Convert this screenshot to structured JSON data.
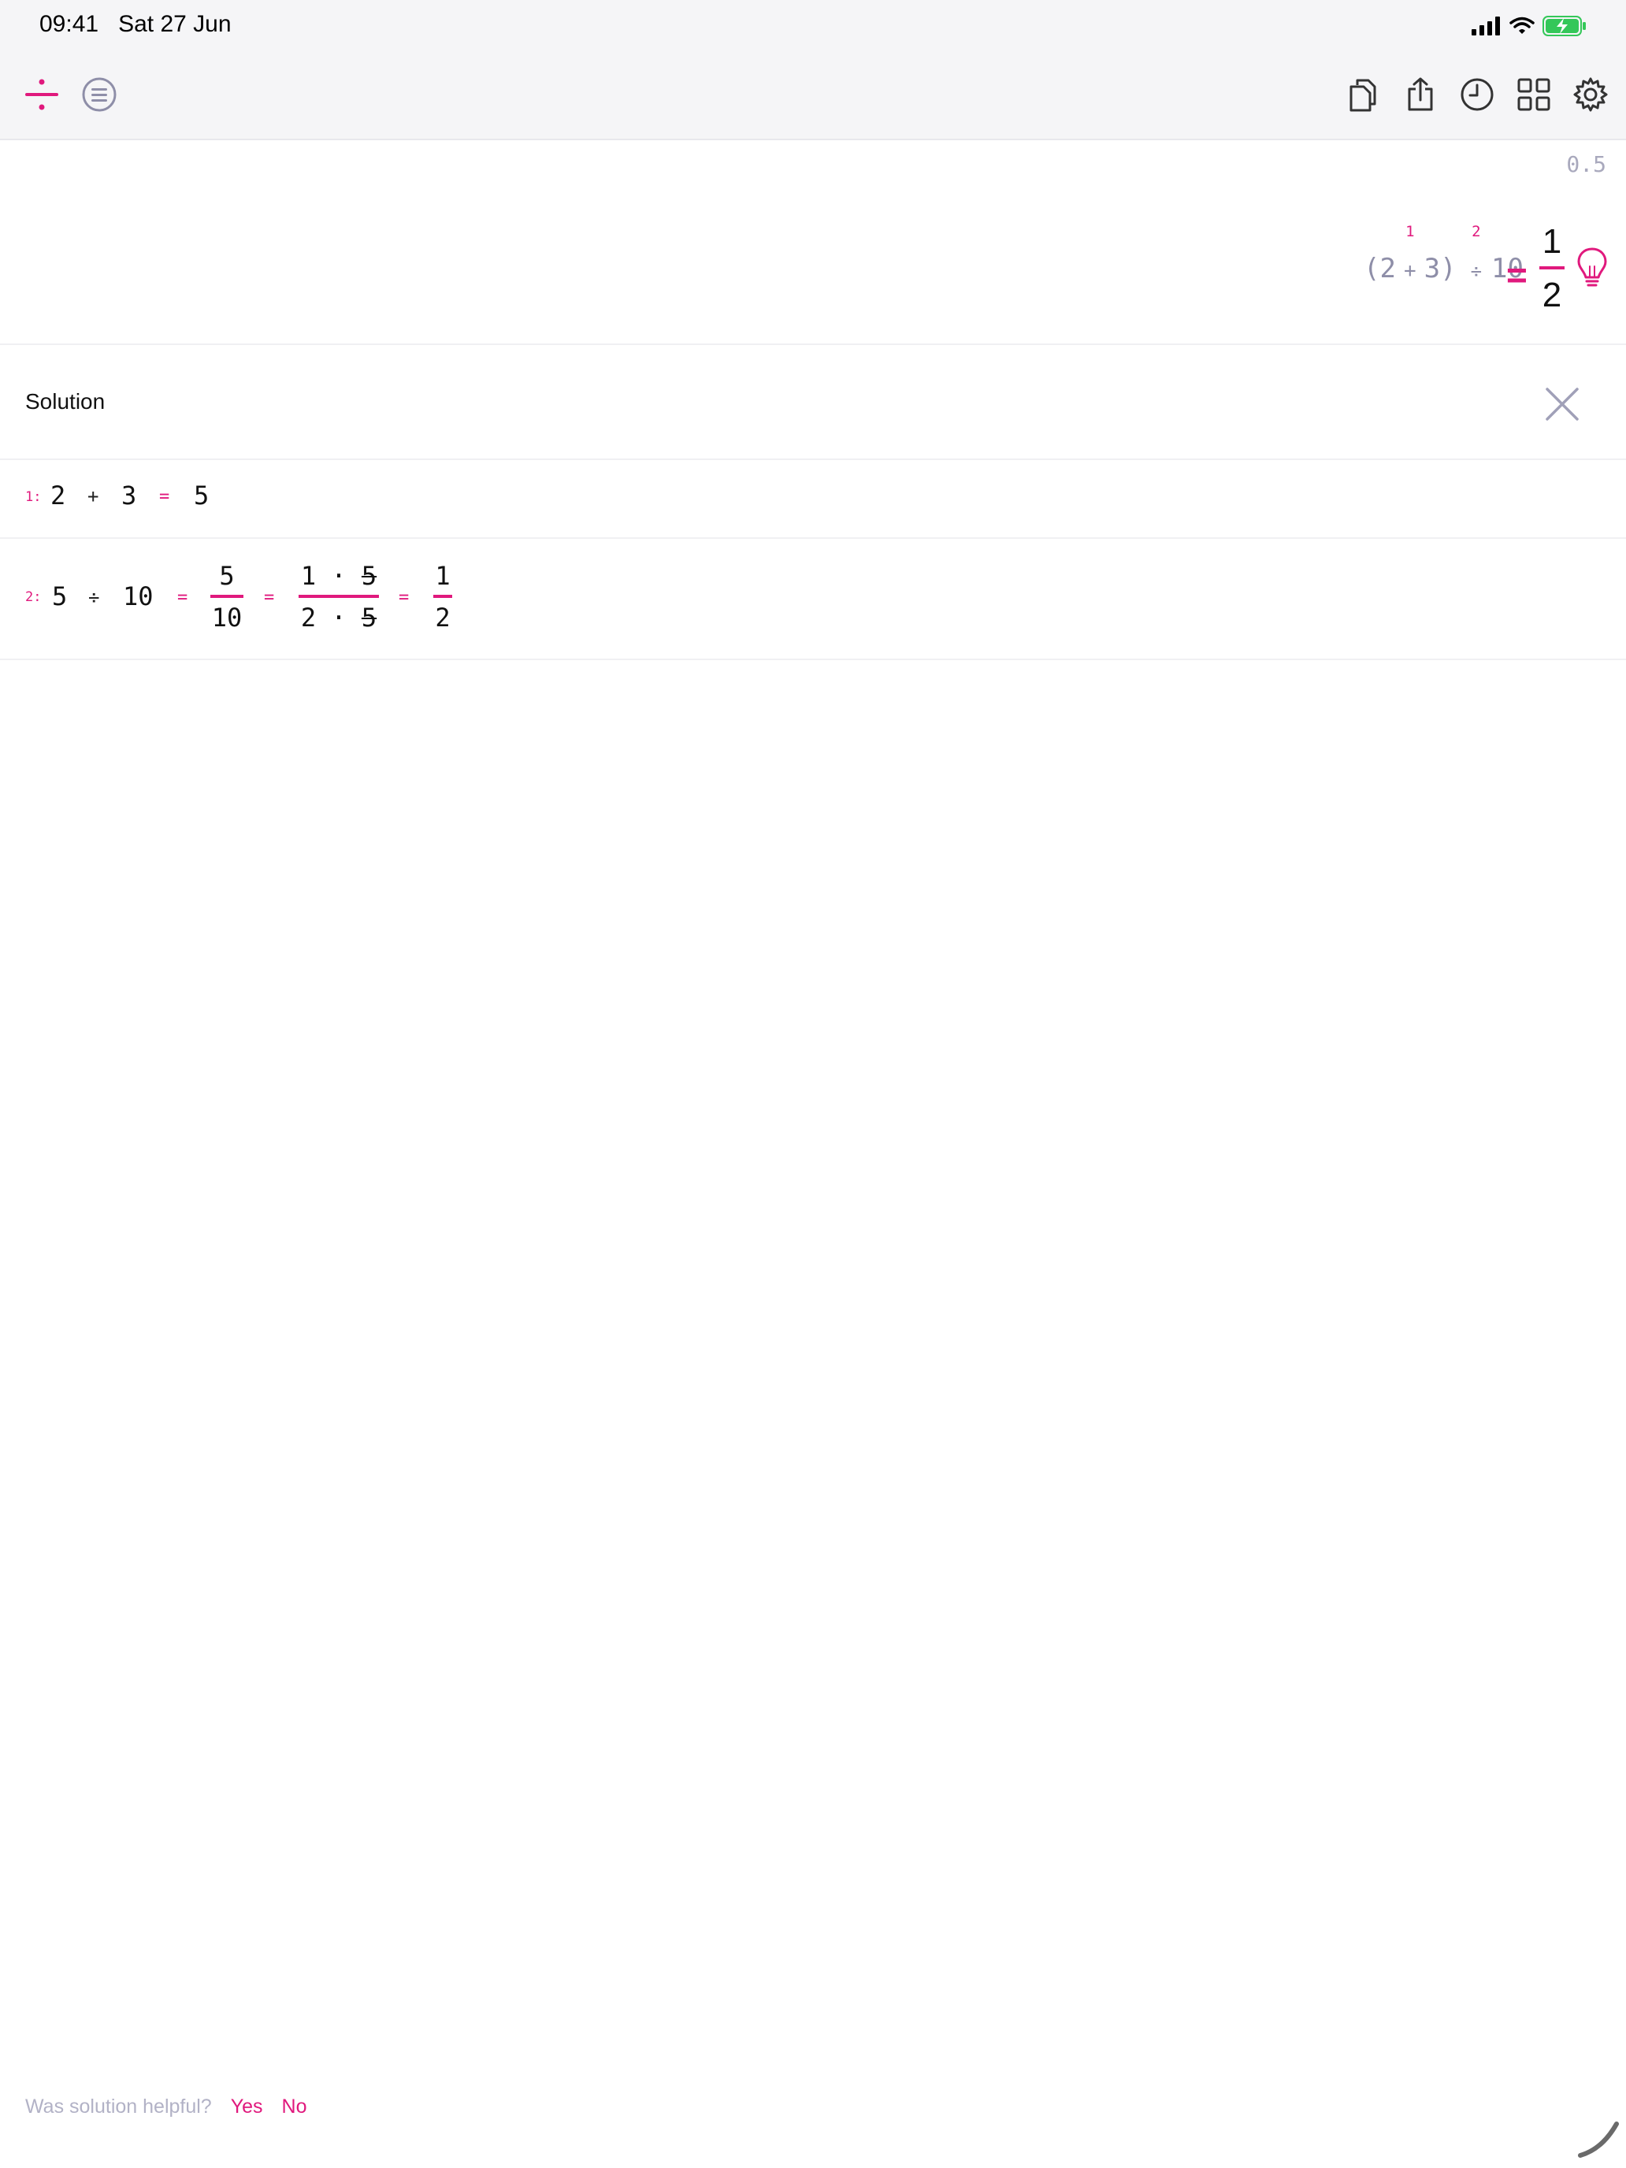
{
  "status_bar": {
    "time": "09:41",
    "date": "Sat 27 Jun",
    "icons": [
      "signal-icon",
      "wifi-icon",
      "battery-charging-icon"
    ],
    "battery_color": "#34c759"
  },
  "toolbar": {
    "left_icons": [
      "divide-icon",
      "equals-circle-icon"
    ],
    "right_icons": [
      "copy-icon",
      "share-icon",
      "history-icon",
      "grid-icon",
      "gear-icon"
    ],
    "accent_color": "#e0197d"
  },
  "display": {
    "preview_value": "0.5",
    "expression": {
      "open_paren": "(",
      "a": "2",
      "plus": "+",
      "b": "3",
      "close_paren": ")",
      "div": "÷",
      "c": "10",
      "step1": "1",
      "step2": "2"
    },
    "equals": "=",
    "result_num": "1",
    "result_den": "2",
    "hint_icon": "lightbulb-icon"
  },
  "solution": {
    "title": "Solution",
    "close_icon": "close-icon",
    "steps": [
      {
        "index": "1:",
        "a": "2",
        "op": "+",
        "b": "3",
        "eq": "=",
        "result": "5"
      },
      {
        "index": "2:",
        "a": "5",
        "op": "÷",
        "b": "10",
        "eq1": "=",
        "f1_num": "5",
        "f1_den": "10",
        "eq2": "=",
        "f2_num_a": "1",
        "f2_dot": "·",
        "f2_num_b": "5",
        "f2_den_a": "2",
        "f2_den_b": "5",
        "eq3": "=",
        "f3_num": "1",
        "f3_den": "2"
      }
    ]
  },
  "feedback": {
    "question": "Was solution helpful?",
    "yes": "Yes",
    "no": "No"
  }
}
